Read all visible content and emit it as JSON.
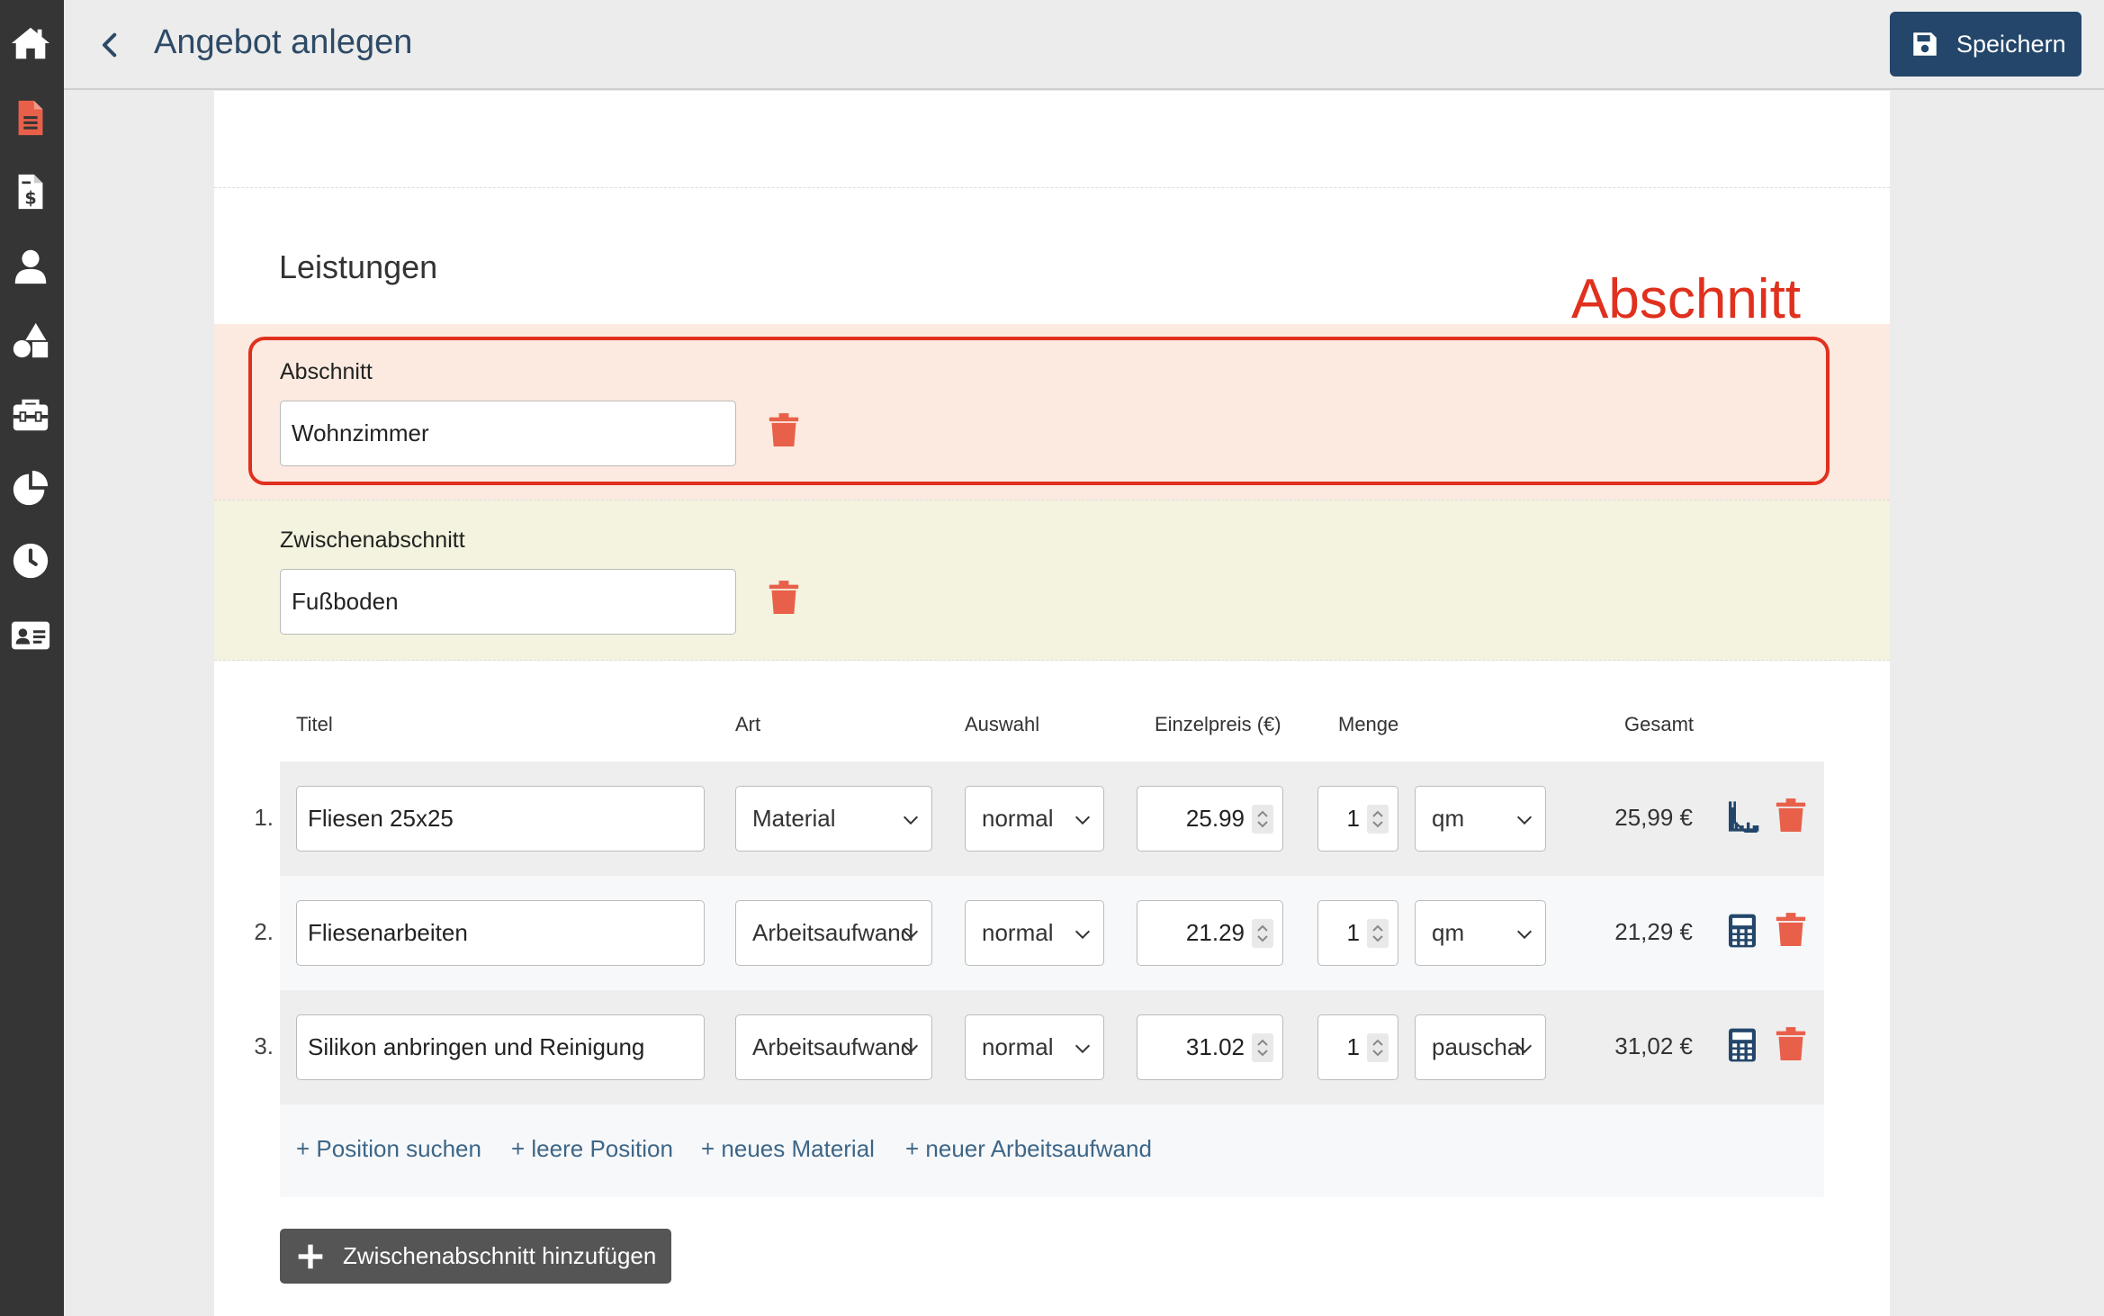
{
  "header": {
    "title": "Angebot anlegen",
    "save_label": "Speichern"
  },
  "sidebar": {
    "icons": [
      "home-icon",
      "document-icon",
      "invoice-icon",
      "user-icon",
      "shapes-icon",
      "toolbox-icon",
      "pie-chart-icon",
      "clock-icon",
      "contact-card-icon"
    ]
  },
  "section": {
    "title": "Leistungen",
    "annotation": "Abschnitt"
  },
  "abschnitt": {
    "label": "Abschnitt",
    "value": "Wohnzimmer"
  },
  "zwischenabschnitt": {
    "label": "Zwischenabschnitt",
    "value": "Fußboden"
  },
  "table": {
    "columns": {
      "titel": "Titel",
      "art": "Art",
      "auswahl": "Auswahl",
      "einzelpreis": "Einzelpreis (€)",
      "menge": "Menge",
      "gesamt": "Gesamt"
    },
    "rows": [
      {
        "num": "1.",
        "title": "Fliesen 25x25",
        "art": "Material",
        "auswahl": "normal",
        "price": "25.99",
        "qty": "1",
        "unit": "qm",
        "total": "25,99 €",
        "icon": "ruler-icon"
      },
      {
        "num": "2.",
        "title": "Fliesenarbeiten",
        "art": "Arbeitsaufwand",
        "auswahl": "normal",
        "price": "21.29",
        "qty": "1",
        "unit": "qm",
        "total": "21,29 €",
        "icon": "calculator-icon"
      },
      {
        "num": "3.",
        "title": "Silikon anbringen und Reinigung",
        "art": "Arbeitsaufwand",
        "auswahl": "normal",
        "price": "31.02",
        "qty": "1",
        "unit": "pauschal",
        "total": "31,02 €",
        "icon": "calculator-icon"
      }
    ]
  },
  "actions": {
    "search": "+ Position suchen",
    "empty": "+ leere Position",
    "material": "+ neues Material",
    "labor": "+ neuer Arbeitsaufwand"
  },
  "add_section_label": "Zwischenabschnitt hinzufügen",
  "colors": {
    "sidebar": "#353535",
    "sidebar_icon": "#ffffff",
    "document_icon": "#e8604a",
    "primary": "#23466a",
    "trash": "#e8604a",
    "annotation": "#e0301e",
    "link": "#3d6687"
  }
}
